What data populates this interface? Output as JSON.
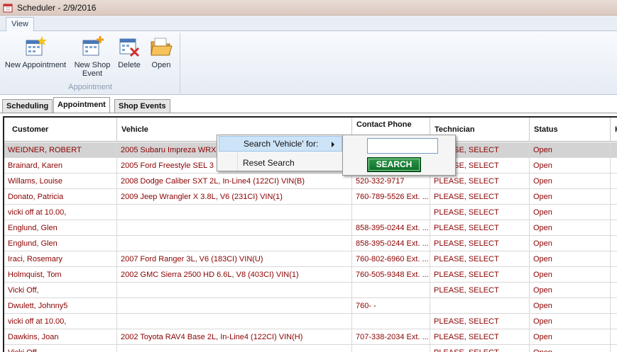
{
  "window": {
    "title": "Scheduler - 2/9/2016"
  },
  "ribbon": {
    "tab": "View",
    "group_label": "Appointment",
    "buttons": [
      {
        "label": "New Appointment",
        "icon": "new-appointment-icon"
      },
      {
        "label": "New Shop Event",
        "icon": "new-shop-event-icon"
      },
      {
        "label": "Delete",
        "icon": "delete-icon"
      },
      {
        "label": "Open",
        "icon": "open-folder-icon"
      }
    ]
  },
  "tabs": [
    "Scheduling",
    "Appointment",
    "Shop Events"
  ],
  "grid": {
    "columns": [
      "Customer",
      "Vehicle",
      "Contact Phone",
      "Technician",
      "Status",
      "H"
    ],
    "rows": [
      [
        "WEIDNER, ROBERT",
        "2005 Subaru Impreza WRX",
        "",
        "PLEASE, SELECT",
        "Open"
      ],
      [
        "Brainard, Karen",
        "2005 Ford Freestyle SEL 3",
        "",
        "PLEASE, SELECT",
        "Open"
      ],
      [
        "Willams, Louise",
        "2008 Dodge Caliber SXT 2L, In-Line4 (122CI) VIN(B)",
        "520-332-9717",
        "PLEASE, SELECT",
        "Open"
      ],
      [
        "Donato, Patricia",
        "2009 Jeep Wrangler X 3.8L, V6 (231CI) VIN(1)",
        "760-789-5526 Ext. ...",
        "PLEASE, SELECT",
        "Open"
      ],
      [
        "vicki off at 10.00,",
        "",
        "",
        "PLEASE, SELECT",
        "Open"
      ],
      [
        "Englund, Glen",
        "",
        "858-395-0244 Ext. ...",
        "PLEASE, SELECT",
        "Open"
      ],
      [
        "Englund, Glen",
        "",
        "858-395-0244 Ext. ...",
        "PLEASE, SELECT",
        "Open"
      ],
      [
        "Iraci, Rosemary",
        "2007 Ford Ranger 3L, V6 (183CI) VIN(U)",
        "760-802-6960 Ext. ...",
        "PLEASE, SELECT",
        "Open"
      ],
      [
        "Holmquist, Tom",
        "2002 GMC Sierra 2500 HD 6.6L, V8 (403CI) VIN(1)",
        "760-505-9348 Ext. ...",
        "PLEASE, SELECT",
        "Open"
      ],
      [
        "Vicki Off,",
        "",
        "",
        "PLEASE, SELECT",
        "Open"
      ],
      [
        "Dwulett, Johnny5",
        "",
        "760-   -",
        "",
        "Open"
      ],
      [
        "vicki off at 10.00,",
        "",
        "",
        "PLEASE, SELECT",
        "Open"
      ],
      [
        "Dawkins, Joan",
        "2002 Toyota RAV4 Base 2L, In-Line4 (122CI) VIN(H)",
        "707-338-2034 Ext. ...",
        "PLEASE, SELECT",
        "Open"
      ],
      [
        "Vicki Off,",
        "",
        "",
        "PLEASE, SELECT",
        "Open"
      ]
    ]
  },
  "context_menu": {
    "items": [
      "Search 'Vehicle' for:",
      "Reset Search"
    ],
    "search_value": "",
    "search_button": "SEARCH"
  },
  "colors": {
    "row_text": "#8b0000",
    "selected_row": "#d3d3d3",
    "search_button": "#1a7f35"
  }
}
